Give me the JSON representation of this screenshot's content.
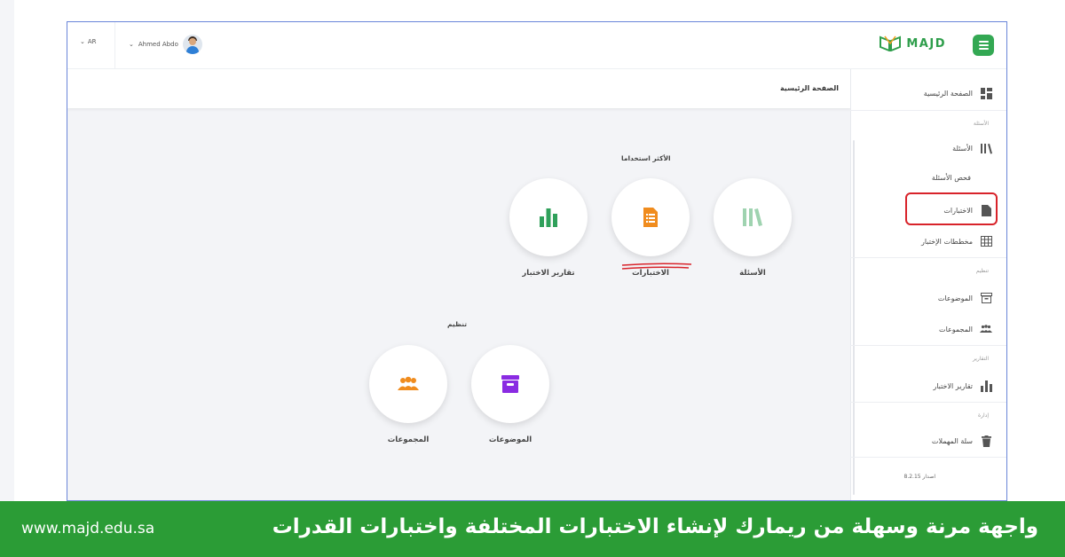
{
  "topbar": {
    "language": "AR",
    "user_name": "Ahmed Abdo",
    "logo_text": "MAJD",
    "brand_color": "#33a853"
  },
  "page": {
    "title": "الصفحة الرئيسية"
  },
  "sidebar": {
    "home": "الصفحة الرئيسية",
    "questions_header": "الأسئلة",
    "questions": "الأسئلة",
    "review_questions": "فحص الأسئلة",
    "exams": "الاختبارات",
    "exam_plans": "مخططات الإختبار",
    "organize_header": "تنظيم",
    "topics": "الموضوعات",
    "groups": "المجموعات",
    "reports_header": "التقارير",
    "exam_reports": "تقارير الاختبار",
    "admin_header": "إدارة",
    "recycle_bin": "سلة المهملات",
    "version": "اصدار 8.2.15"
  },
  "main": {
    "most_used_label": "الأكثر استخداما",
    "organize_label": "تنظيم",
    "tiles": {
      "questions": "الأسئلة",
      "exams": "الاختبارات",
      "exam_reports": "تقارير الاختبار",
      "topics": "الموضوعات",
      "groups": "المجموعات"
    }
  },
  "banner": {
    "url": "www.majd.edu.sa",
    "text": "واجهة مرنة وسهلة من ريمارك لإنشاء الاختبارات المختلفة واختبارات القدرات",
    "color": "#2b9c36"
  },
  "colors": {
    "highlight": "#d8232a",
    "icon_green": "#2fa05a",
    "icon_orange": "#f08c1e",
    "icon_purple": "#8a2be2",
    "icon_light_green": "#9fd3b0"
  }
}
